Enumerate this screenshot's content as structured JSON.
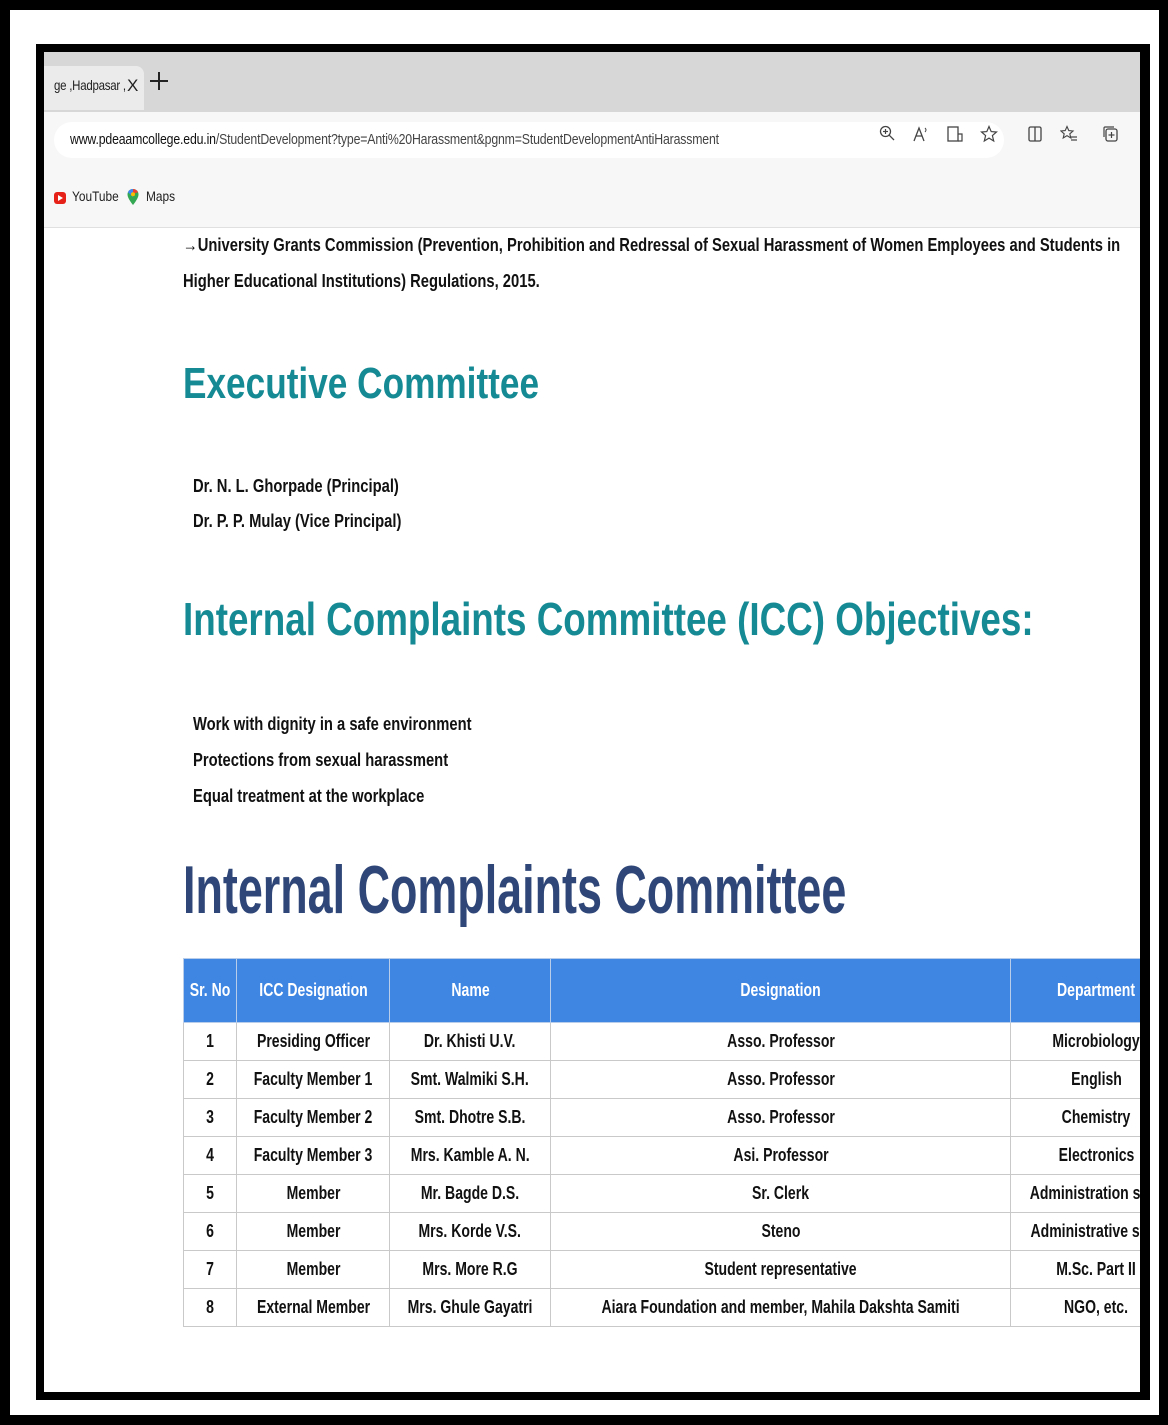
{
  "browser": {
    "tab_title": "ge ,Hadpasar ,",
    "tab_close": "X",
    "url_host": "www.pdeaamcollege.edu.in",
    "url_path": "/StudentDevelopment?type=Anti%20Harassment&pgnm=StudentDevelopmentAntiHarassment",
    "toolbar_icons": [
      "zoom-icon",
      "read-aloud-icon",
      "immersive-reader-icon",
      "favorite-star-icon",
      "split-screen-icon",
      "favorites-icon",
      "collections-icon"
    ],
    "bookmarks": [
      "YouTube",
      "Maps"
    ]
  },
  "page": {
    "intro_line1": "→University Grants Commission (Prevention, Prohibition and Redressal of Sexual Harassment of Women Employees and Students in",
    "intro_line2": "Higher Educational Institutions) Regulations, 2015.",
    "executive_heading": "Executive Committee",
    "executive_members": [
      "Dr. N. L. Ghorpade (Principal)",
      "Dr. P. P. Mulay (Vice Principal)"
    ],
    "objectives_heading": "Internal Complaints Committee (ICC) Objectives:",
    "objectives": [
      "Work with dignity in a safe environment",
      "Protections from sexual harassment",
      "Equal treatment at the workplace"
    ],
    "icc_heading": "Internal Complaints Committee",
    "table": {
      "headers": [
        "Sr. No",
        "ICC Designation",
        "Name",
        "Designation",
        "Department"
      ],
      "rows": [
        [
          "1",
          "Presiding Officer",
          "Dr. Khisti U.V.",
          "Asso. Professor",
          "Microbiology"
        ],
        [
          "2",
          "Faculty Member 1",
          "Smt. Walmiki S.H.",
          "Asso. Professor",
          "English"
        ],
        [
          "3",
          "Faculty Member 2",
          "Smt. Dhotre S.B.",
          "Asso. Professor",
          "Chemistry"
        ],
        [
          "4",
          "Faculty Member 3",
          "Mrs. Kamble A. N.",
          "Asi. Professor",
          "Electronics"
        ],
        [
          "5",
          "Member",
          "Mr. Bagde D.S.",
          "Sr. Clerk",
          "Administration staff"
        ],
        [
          "6",
          "Member",
          "Mrs. Korde V.S.",
          "Steno",
          "Administrative staff"
        ],
        [
          "7",
          "Member",
          "Mrs. More R.G",
          "Student representative",
          "M.Sc. Part II"
        ],
        [
          "8",
          "External Member",
          "Mrs. Ghule Gayatri",
          "Aiara Foundation and member, Mahila Dakshta Samiti",
          "NGO, etc."
        ]
      ]
    }
  }
}
